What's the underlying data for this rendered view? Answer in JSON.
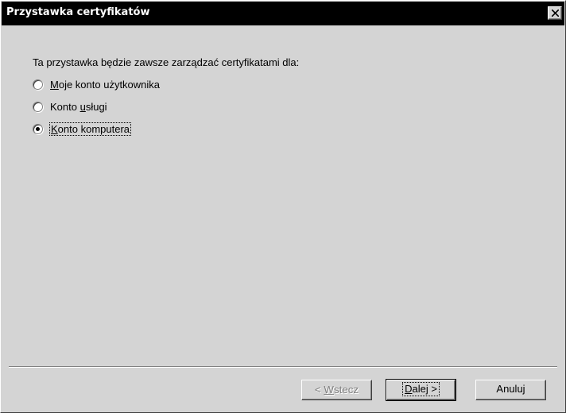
{
  "window": {
    "title": "Przystawka certyfikatów",
    "close_symbol": "×"
  },
  "content": {
    "intro": "Ta przystawka będzie zawsze zarządzać certyfikatami dla:",
    "options": [
      {
        "pre": "",
        "u": "M",
        "post": "oje konto użytkownika",
        "selected": false
      },
      {
        "pre": "Konto ",
        "u": "u",
        "post": "sługi",
        "selected": false
      },
      {
        "pre": "",
        "u": "K",
        "post": "onto komputera",
        "selected": true
      }
    ]
  },
  "buttons": {
    "back": {
      "pre": "< ",
      "u": "W",
      "post": "stecz",
      "enabled": false
    },
    "next": {
      "pre": "",
      "u": "D",
      "post": "alej >",
      "enabled": true
    },
    "cancel": {
      "label": "Anuluj",
      "enabled": true
    }
  }
}
